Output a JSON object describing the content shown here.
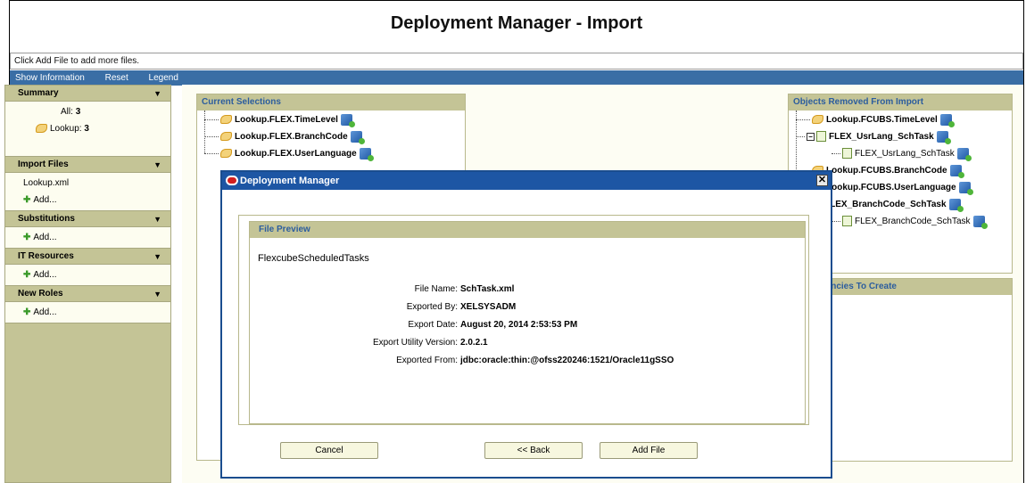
{
  "page": {
    "title": "Deployment Manager - Import"
  },
  "hint": "Click Add File to add more files.",
  "menu": [
    "Show Information",
    "Reset",
    "Legend"
  ],
  "sidebar": {
    "summary": {
      "title": "Summary",
      "all_label": "All:",
      "all_count": "3",
      "lookup_label": "Lookup:",
      "lookup_count": "3"
    },
    "import_files": {
      "title": "Import Files",
      "file": "Lookup.xml",
      "add": "Add..."
    },
    "substitutions": {
      "title": "Substitutions",
      "add": "Add..."
    },
    "it_resources": {
      "title": "IT Resources",
      "add": "Add..."
    },
    "new_roles": {
      "title": "New Roles",
      "add": "Add..."
    }
  },
  "current_selections": {
    "title": "Current Selections",
    "items": [
      "Lookup.FLEX.TimeLevel",
      "Lookup.FLEX.BranchCode",
      "Lookup.FLEX.UserLanguage"
    ]
  },
  "removed": {
    "title": "Objects Removed From Import",
    "items": [
      "Lookup.FCUBS.TimeLevel",
      "FLEX_UsrLang_SchTask",
      "FLEX_UsrLang_SchTask",
      "Lookup.FCUBS.BranchCode",
      "Lookup.FCUBS.UserLanguage",
      "FLEX_BranchCode_SchTask",
      "FLEX_BranchCode_SchTask"
    ]
  },
  "dependencies": {
    "title": "Dependencies To Create"
  },
  "dialog": {
    "title": "Deployment Manager",
    "preview_title": "File Preview",
    "task_name": "FlexcubeScheduledTasks",
    "fields": [
      {
        "label": "File Name:",
        "value": "SchTask.xml"
      },
      {
        "label": "Exported By:",
        "value": "XELSYSADM"
      },
      {
        "label": "Export Date:",
        "value": "August 20, 2014 2:53:53 PM"
      },
      {
        "label": "Export Utility Version:",
        "value": "2.0.2.1"
      },
      {
        "label": "Exported From:",
        "value": "jdbc:oracle:thin:@ofss220246:1521/Oracle11gSSO"
      }
    ],
    "buttons": {
      "cancel": "Cancel",
      "back": "<< Back",
      "add_file": "Add File"
    }
  }
}
